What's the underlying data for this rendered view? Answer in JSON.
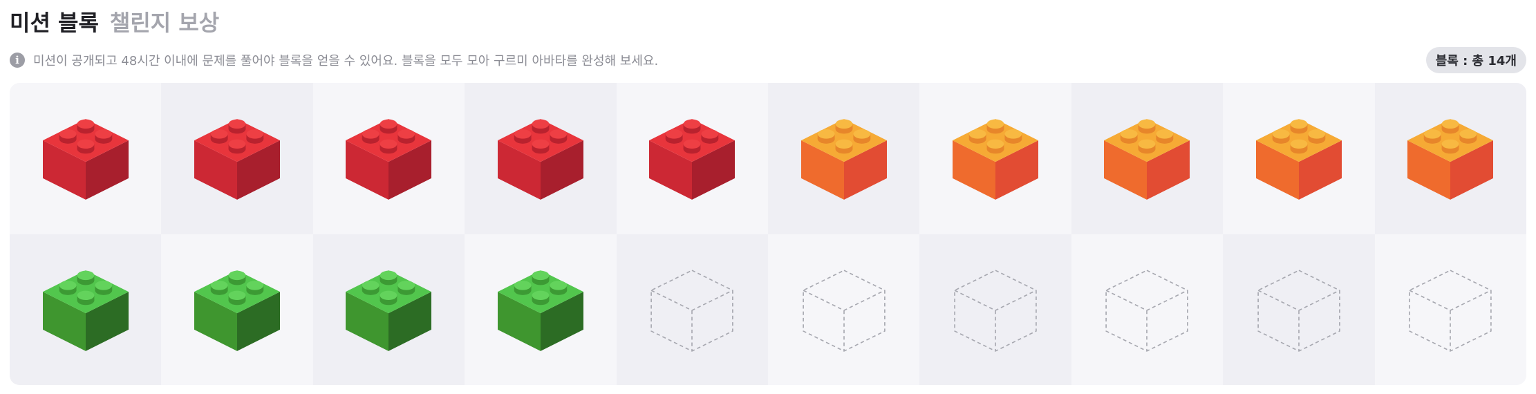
{
  "header": {
    "title": "미션 블록",
    "subtitle": "챌린지 보상"
  },
  "info": {
    "icon": "info-icon",
    "text": "미션이 공개되고 48시간 이내에 문제를 풀어야 블록을 얻을 수 있어요. 블록을 모두 모아 구르미 아바타를 완성해 보세요.",
    "badge": "블록 : 총 14개"
  },
  "colors": {
    "red": {
      "top": "#e8353c",
      "left": "#cc2834",
      "right": "#a81f2d",
      "stud_top": "#ee3f44",
      "stud_side": "#b9222e"
    },
    "orange": {
      "top": "#f6aa35",
      "left": "#ef6b2d",
      "right": "#e24c33",
      "stud_top": "#f8b942",
      "stud_side": "#e7862a"
    },
    "green": {
      "top": "#52c64d",
      "left": "#3f962f",
      "right": "#2c6c24",
      "stud_top": "#63d35c",
      "stud_side": "#3c9a34"
    },
    "empty_outline": "#a7a8b0",
    "cell_light": "#f6f6f9",
    "cell_dark": "#efeff4"
  },
  "blocks": [
    {
      "color": "red",
      "collected": true
    },
    {
      "color": "red",
      "collected": true
    },
    {
      "color": "red",
      "collected": true
    },
    {
      "color": "red",
      "collected": true
    },
    {
      "color": "red",
      "collected": true
    },
    {
      "color": "orange",
      "collected": true
    },
    {
      "color": "orange",
      "collected": true
    },
    {
      "color": "orange",
      "collected": true
    },
    {
      "color": "orange",
      "collected": true
    },
    {
      "color": "orange",
      "collected": true
    },
    {
      "color": "green",
      "collected": true
    },
    {
      "color": "green",
      "collected": true
    },
    {
      "color": "green",
      "collected": true
    },
    {
      "color": "green",
      "collected": true
    },
    {
      "color": "empty",
      "collected": false
    },
    {
      "color": "empty",
      "collected": false
    },
    {
      "color": "empty",
      "collected": false
    },
    {
      "color": "empty",
      "collected": false
    },
    {
      "color": "empty",
      "collected": false
    },
    {
      "color": "empty",
      "collected": false
    }
  ]
}
